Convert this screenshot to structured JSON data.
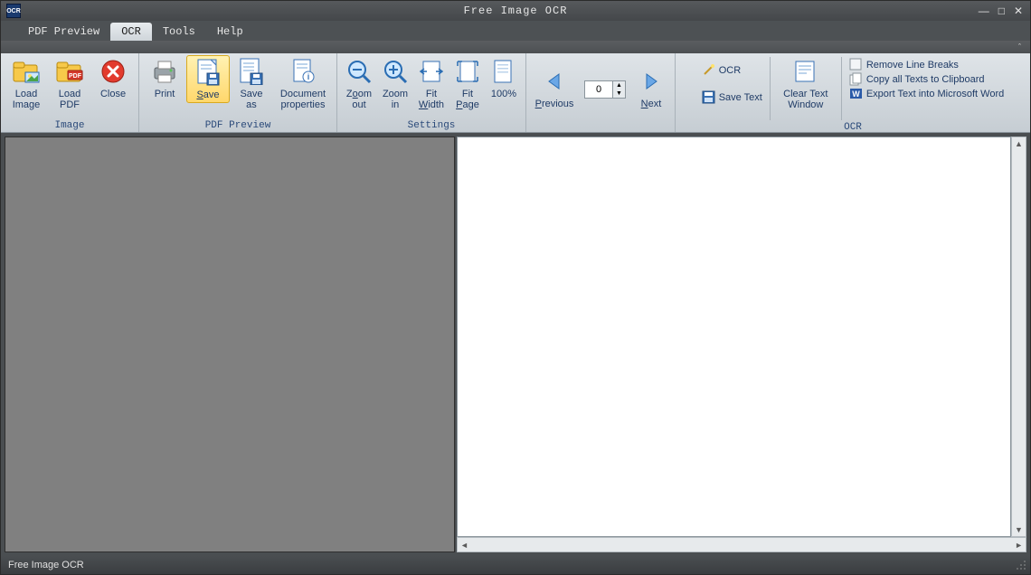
{
  "title": "Free Image OCR",
  "tabs": [
    "PDF Preview",
    "OCR",
    "Tools",
    "Help"
  ],
  "active_tab": 1,
  "ribbon": {
    "groups": [
      {
        "label": "Image",
        "items": [
          {
            "id": "load-image",
            "label": "Load\nImage",
            "icon": "folder-image"
          },
          {
            "id": "load-pdf",
            "label": "Load\nPDF",
            "icon": "folder-pdf"
          },
          {
            "id": "close",
            "label": "Close",
            "icon": "close-red"
          }
        ]
      },
      {
        "label": "PDF Preview",
        "items": [
          {
            "id": "print",
            "label": "Print",
            "icon": "printer"
          },
          {
            "id": "save",
            "label": "Save",
            "icon": "save-doc",
            "ul": 0,
            "highlight": true
          },
          {
            "id": "save-as",
            "label": "Save\nas",
            "icon": "save-as"
          },
          {
            "id": "doc-props",
            "label": "Document\nproperties",
            "icon": "doc-props",
            "wide": true
          }
        ]
      },
      {
        "label": "Settings",
        "items": [
          {
            "id": "zoom-out",
            "label": "Zoom\nout",
            "icon": "zoom-out",
            "ul": 1
          },
          {
            "id": "zoom-in",
            "label": "Zoom\nin",
            "icon": "zoom-in"
          },
          {
            "id": "fit-width",
            "label": "Fit\nWidth",
            "icon": "fit-width",
            "ul": 4
          },
          {
            "id": "fit-page",
            "label": "Fit\nPage",
            "icon": "fit-page",
            "ul": 4
          },
          {
            "id": "zoom-100",
            "label": "100%",
            "icon": "doc-100"
          }
        ]
      },
      {
        "label": "",
        "items": [
          {
            "id": "previous",
            "label": "Previous",
            "icon": "nav-prev",
            "ul": 0,
            "nav": true
          },
          {
            "id": "page",
            "label": "",
            "icon": "",
            "page": true,
            "value": "0"
          },
          {
            "id": "next",
            "label": "Next",
            "icon": "nav-next",
            "ul": 0,
            "nav": true
          }
        ]
      },
      {
        "label": "OCR",
        "items": [
          {
            "id": "ocr-col",
            "mini": true,
            "rows": [
              {
                "id": "ocr",
                "label": "OCR",
                "icon": "wand"
              },
              {
                "id": "save-text",
                "label": "Save Text",
                "icon": "save-text"
              }
            ]
          },
          {
            "id": "clear-text",
            "label": "Clear Text\nWindow",
            "icon": "clear-text",
            "wide": true
          },
          {
            "id": "export-col",
            "mini": true,
            "rows": [
              {
                "id": "remove-breaks",
                "label": "Remove Line Breaks",
                "icon": "checkbox"
              },
              {
                "id": "copy-all",
                "label": "Copy all Texts to Clipboard",
                "icon": "copy"
              },
              {
                "id": "export-word",
                "label": "Export Text into Microsoft Word",
                "icon": "word"
              }
            ]
          }
        ]
      }
    ]
  },
  "page_value": "0",
  "status": "Free Image OCR"
}
